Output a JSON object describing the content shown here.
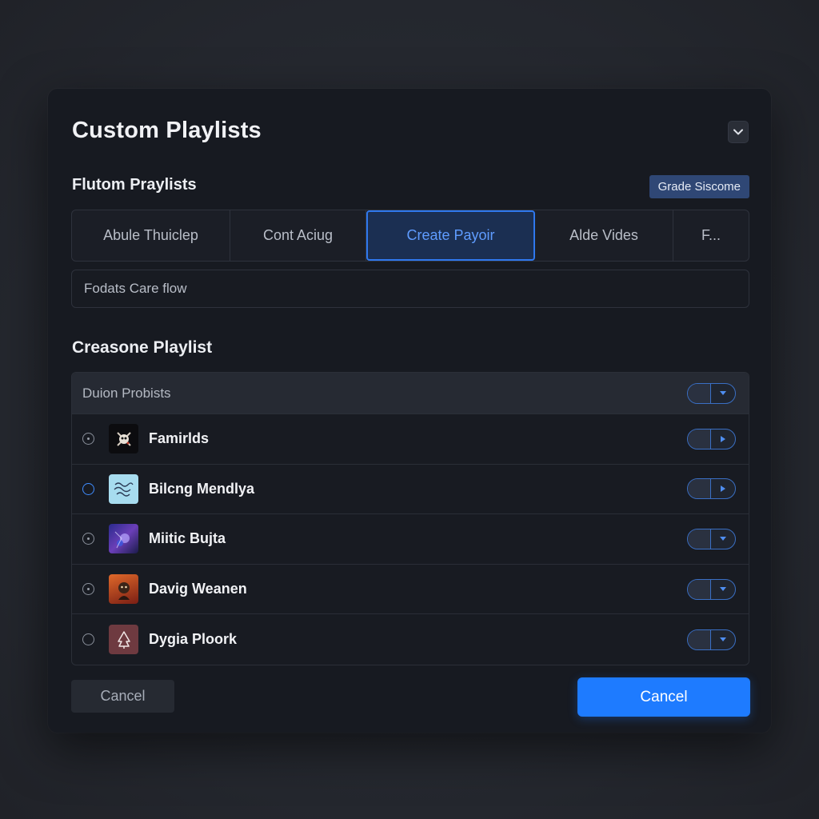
{
  "dialog": {
    "title": "Custom Playlists",
    "subtitle": "Flutom Praylists",
    "badge_label": "Grade Siscome"
  },
  "tabs": [
    {
      "label": "Abule Thuiclep",
      "active": false
    },
    {
      "label": "Cont Aciug",
      "active": false
    },
    {
      "label": "Create Payoir",
      "active": true
    },
    {
      "label": "Alde Vides",
      "active": false
    },
    {
      "label": "F...",
      "active": false
    }
  ],
  "field": {
    "value": "Fodats Care flow"
  },
  "section": {
    "title": "Creasone Playlist"
  },
  "list": {
    "header_label": "Duion Probists",
    "items": [
      {
        "label": "Famirlds",
        "thumb_icon": "skull-art-icon",
        "toggle_icon": "arrow-right-icon",
        "radio_selected": false
      },
      {
        "label": "Bilcng Mendlya",
        "thumb_icon": "script-art-icon",
        "toggle_icon": "arrow-right-icon",
        "radio_selected": true
      },
      {
        "label": "Miitic Bujta",
        "thumb_icon": "nebula-art-icon",
        "toggle_icon": "arrow-down-icon",
        "radio_selected": false
      },
      {
        "label": "Davig Weanen",
        "thumb_icon": "portrait-art-icon",
        "toggle_icon": "arrow-down-icon",
        "radio_selected": false
      },
      {
        "label": "Dygia Ploork",
        "thumb_icon": "tree-art-icon",
        "toggle_icon": "arrow-down-icon",
        "radio_selected": false
      }
    ]
  },
  "footer": {
    "secondary_label": "Cancel",
    "primary_label": "Cancel"
  },
  "colors": {
    "accent": "#1e7bff",
    "tab_active_text": "#5f9cff",
    "badge_bg": "#2f4775",
    "dialog_bg": "#171a21"
  }
}
